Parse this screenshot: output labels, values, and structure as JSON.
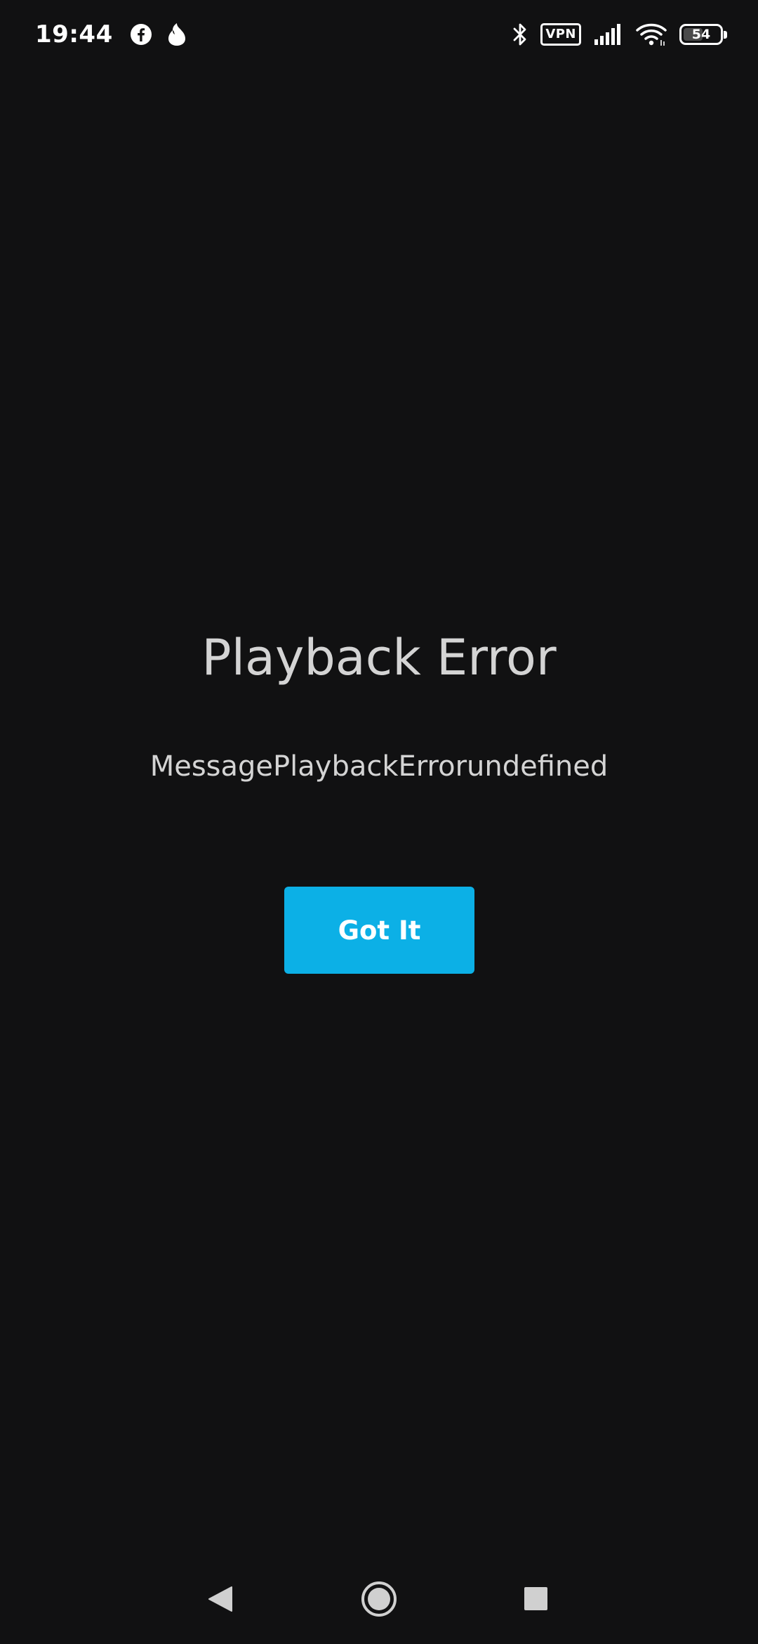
{
  "status_bar": {
    "time": "19:44",
    "left_icons": [
      "facebook-icon",
      "tinder-flame-icon"
    ],
    "right_icons": [
      "bluetooth-icon",
      "vpn-icon",
      "signal-icon",
      "wifi-icon",
      "battery-icon"
    ],
    "vpn_label": "VPN",
    "battery_level": "54",
    "battery_fraction": 0.54
  },
  "dialog": {
    "title": "Playback Error",
    "message": "MessagePlaybackErrorundefined",
    "button_label": "Got It",
    "button_color": "#0cb0e6"
  },
  "nav_bar": {
    "buttons": [
      "back-icon",
      "home-icon",
      "recents-icon"
    ]
  },
  "colors": {
    "background": "#111112",
    "text": "#d4d4d4",
    "accent": "#0cb0e6"
  }
}
